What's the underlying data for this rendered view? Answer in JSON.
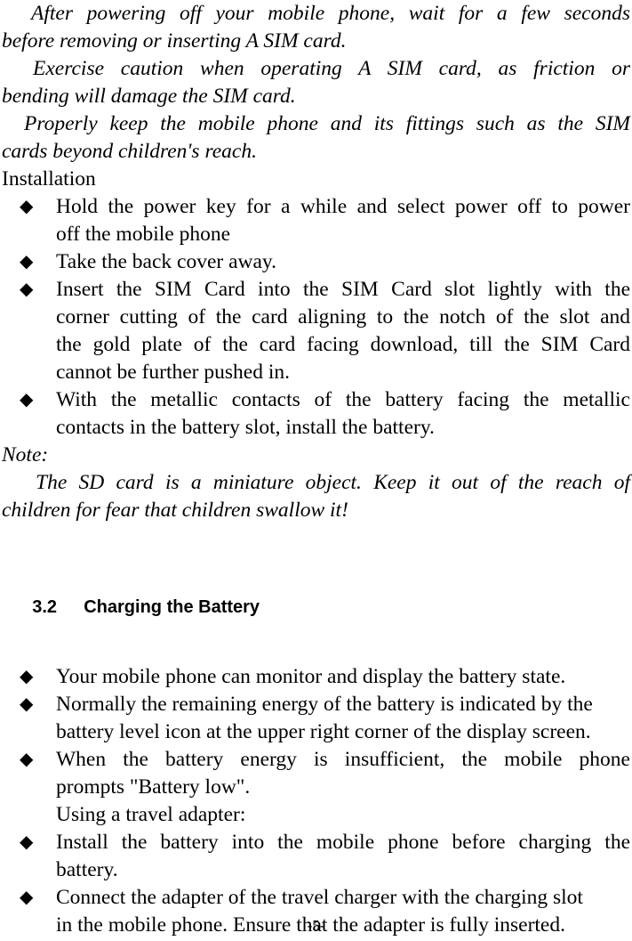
{
  "document": {
    "page_number": "-5-",
    "bullet_glyph": "◆",
    "text_color": "#000000",
    "background_color": "#ffffff"
  },
  "intro_paragraphs": [
    {
      "style": "italic",
      "lines": [
        "After powering off your mobile phone, wait for a few seconds",
        "before removing or inserting A SIM card."
      ],
      "full_text": "After powering off your mobile phone, wait for a few seconds before removing or inserting A SIM card."
    },
    {
      "style": "italic",
      "lines": [
        "Exercise caution when operating A SIM card, as friction or",
        "bending will damage the SIM card."
      ],
      "full_text": "Exercise caution when operating A SIM card, as friction or bending will damage the SIM card."
    },
    {
      "style": "italic",
      "lines": [
        "Properly keep the mobile phone and its fittings such as the SIM",
        "cards beyond children's reach."
      ],
      "full_text": "Properly keep the mobile phone and its fittings such as the SIM cards beyond children's reach."
    }
  ],
  "installation": {
    "label": "Installation",
    "bullets": [
      {
        "lines": [
          "Hold the power key for a while and select power off to power",
          "off the mobile phone"
        ],
        "full_text": "Hold the power key for a while and select power off to power off the mobile phone"
      },
      {
        "lines": [
          "Take the back cover away."
        ],
        "full_text": "Take the back cover away."
      },
      {
        "lines": [
          "Insert the SIM Card into the SIM Card slot lightly with the",
          "corner cutting of the card aligning to the notch of the slot and",
          "the gold plate of the card facing download, till the SIM Card",
          "cannot be further pushed in."
        ],
        "full_text": "Insert the SIM Card into the SIM Card slot lightly with the corner cutting of the card aligning to the notch of the slot and the gold plate of the card facing download, till the SIM Card cannot be further pushed in."
      },
      {
        "lines": [
          "With the metallic contacts of the battery facing the metallic",
          "contacts in the battery slot, install the battery."
        ],
        "full_text": "With the metallic contacts of the battery facing the metallic contacts in the battery slot, install the battery."
      }
    ]
  },
  "note": {
    "label": "Note:",
    "lines": [
      "The SD card is a miniature object. Keep it out of the reach of",
      "children for fear that children swallow it!"
    ],
    "full_text": "The SD card is a miniature object. Keep it out of the reach of children for fear that children swallow it!"
  },
  "section": {
    "number": "3.2",
    "title": "Charging the Battery",
    "bullets": [
      {
        "lines": [
          "Your mobile phone can monitor and display the battery state."
        ],
        "full_text": "Your mobile phone can monitor and display the battery state."
      },
      {
        "lines": [
          "Normally the remaining energy of the battery is indicated by the",
          "battery level icon at the upper right corner of the display screen."
        ],
        "full_text": "Normally the remaining energy of the battery is indicated by the battery level icon at the upper right corner of the display screen."
      },
      {
        "lines": [
          "When the battery energy is insufficient, the mobile phone",
          "prompts \"Battery low\"."
        ],
        "full_text": "When the battery energy is insufficient, the mobile phone prompts \"Battery low\"."
      }
    ],
    "sub_note": "Using a travel adapter:",
    "bullets_after": [
      {
        "lines": [
          "Install the battery into the mobile phone before charging the",
          "battery."
        ],
        "full_text": "Install the battery into the mobile phone before charging the battery."
      },
      {
        "lines": [
          "Connect the adapter of the travel charger with the charging slot",
          "in the mobile phone. Ensure that the adapter is fully inserted."
        ],
        "full_text": "Connect the adapter of the travel charger with the charging slot in the mobile phone. Ensure that the adapter is fully inserted."
      }
    ]
  }
}
